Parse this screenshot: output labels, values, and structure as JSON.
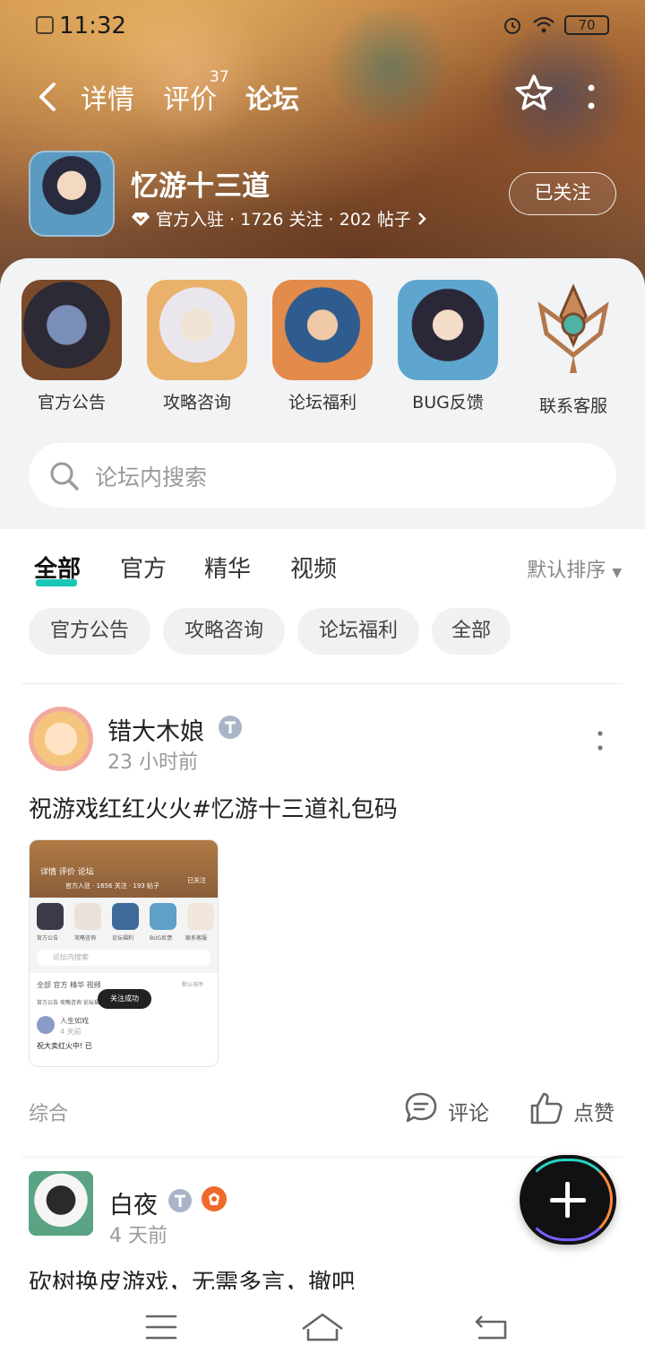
{
  "status_bar": {
    "time": "11:32",
    "battery": "70"
  },
  "nav": {
    "tabs": [
      {
        "label": "详情"
      },
      {
        "label": "评价",
        "count": "37"
      },
      {
        "label": "论坛"
      }
    ]
  },
  "game": {
    "name": "忆游十三道",
    "meta": "官方入驻 · 1726 关注 · 202 帖子",
    "follow_label": "已关注"
  },
  "categories": [
    {
      "label": "官方公告",
      "icon": "official-announcement-icon"
    },
    {
      "label": "攻略咨询",
      "icon": "strategy-icon"
    },
    {
      "label": "论坛福利",
      "icon": "forum-welfare-icon"
    },
    {
      "label": "BUG反馈",
      "icon": "bug-feedback-icon"
    },
    {
      "label": "联系客服",
      "icon": "customer-service-icon"
    }
  ],
  "search": {
    "placeholder": "论坛内搜索"
  },
  "filter_tabs": [
    "全部",
    "官方",
    "精华",
    "视频"
  ],
  "sort_label": "默认排序",
  "chips": [
    "官方公告",
    "攻略咨询",
    "论坛福利",
    "全部"
  ],
  "posts": [
    {
      "author": "错大木娘",
      "time": "23 小时前",
      "text": "祝游戏红红火火#忆游十三道礼包码",
      "screenshot": {
        "tabs": "详情  评价  论坛",
        "meta": "官方入驻 · 1656 关注 · 193 帖子",
        "follow": "已关注",
        "cats": [
          "官方公告",
          "攻略咨询",
          "论坛福利",
          "BUG反馈",
          "联系客服"
        ],
        "search": "论坛内搜索",
        "ftabs": "全部   官方   精华   视频",
        "sort": "默认排序",
        "chips": "官方公告   攻略咨询   论坛福利   BUG反馈   全部",
        "author": "人生如戏",
        "time": "4 天前",
        "text": "祝大卖红火中! 已",
        "toast": "关注成功"
      },
      "tag": "综合",
      "comment_label": "评论",
      "like_label": "点赞"
    },
    {
      "author": "白夜",
      "time": "4 天前",
      "text": "砍树换皮游戏，无需多言，撤吧"
    }
  ]
}
